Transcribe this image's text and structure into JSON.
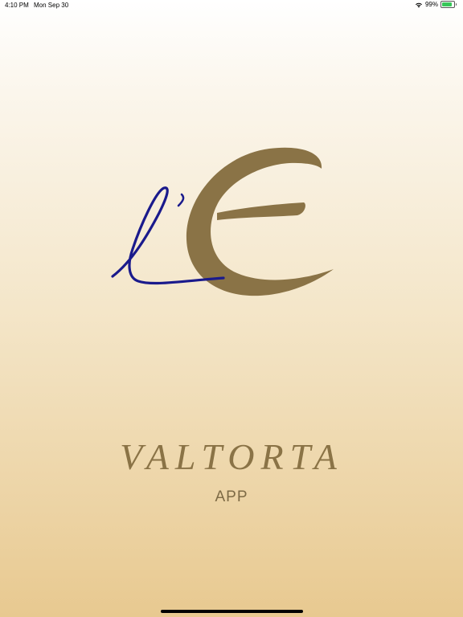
{
  "status_bar": {
    "time": "4:10 PM",
    "date": "Mon Sep 30",
    "battery": "99%",
    "battery_level_percent": 99,
    "icons": [
      "wifi-icon",
      "battery-icon"
    ]
  },
  "splash": {
    "title": "VALTORTA",
    "subtitle": "APP",
    "logo": "lE-monogram-logo"
  },
  "colors": {
    "brand_gold": "#8a7346",
    "brand_blue": "#1a1a8c",
    "background_top": "#ffffff",
    "background_bottom": "#e8c990"
  }
}
